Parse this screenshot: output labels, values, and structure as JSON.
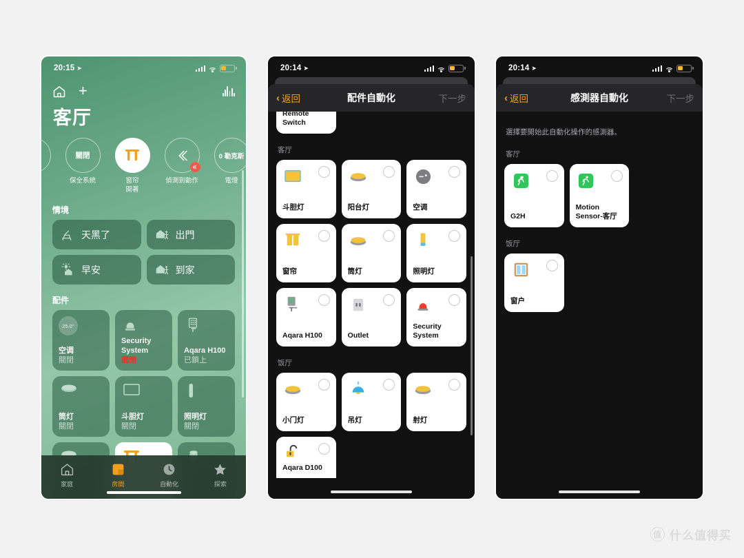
{
  "background_color": "#f2f2f2",
  "screen1": {
    "status_bar": {
      "time": "20:15",
      "location_icon": "location-arrow-icon",
      "cellular_icon": "cellular-bars-icon",
      "wifi_icon": "wifi-icon",
      "battery_icon": "battery-low-icon",
      "battery_color": "#f5b933"
    },
    "nav": {
      "home_icon": "home-icon",
      "add_icon": "plus-icon",
      "intercom_icon": "audio-waveform-icon"
    },
    "room_title": "客厅",
    "status_circles": [
      {
        "value": "",
        "label": "",
        "filled": false,
        "partial": true,
        "icon": "thermostat-dial-icon"
      },
      {
        "value": "關閉",
        "label": "保全系統",
        "filled": false,
        "icon": ""
      },
      {
        "value": "",
        "label": "窗帘\n開著",
        "filled": true,
        "icon": "curtain-icon"
      },
      {
        "value": "",
        "label": "偵測到動作",
        "filled": false,
        "icon": "motion-waves-icon",
        "badge": "motion-badge"
      },
      {
        "value": "0 勒克斯",
        "label": "電燈",
        "filled": false,
        "icon": ""
      }
    ],
    "scenes_title": "情境",
    "scenes": [
      {
        "label": "天黑了",
        "icon": "lounge-chair-icon"
      },
      {
        "label": "出門",
        "icon": "house-leave-icon"
      },
      {
        "label": "早安",
        "icon": "sunrise-house-icon"
      },
      {
        "label": "到家",
        "icon": "house-arrive-icon"
      }
    ],
    "accessories_title": "配件",
    "accessories": [
      {
        "name": "空调",
        "state": "關閉",
        "icon": "thermostat-icon",
        "badge": "25.0°",
        "on": false
      },
      {
        "name": "Security System",
        "state": "關閉",
        "state_alert": true,
        "icon": "siren-icon",
        "on": false
      },
      {
        "name": "Aqara H100",
        "state": "已鎖上",
        "icon": "smart-lock-icon",
        "on": false
      },
      {
        "name": "筒灯",
        "state": "關閉",
        "icon": "downlight-icon",
        "on": false
      },
      {
        "name": "斗胆灯",
        "state": "關閉",
        "icon": "panel-light-icon",
        "on": false
      },
      {
        "name": "照明灯",
        "state": "關閉",
        "icon": "light-strip-icon",
        "on": false
      },
      {
        "name": "",
        "state": "",
        "icon": "downlight-icon",
        "on": false
      },
      {
        "name": "",
        "state": "",
        "icon": "curtain-icon",
        "on": true
      },
      {
        "name": "",
        "state": "",
        "icon": "speaker-icon",
        "on": false
      }
    ],
    "tabs": [
      {
        "label": "家庭",
        "icon": "home-icon",
        "active": false
      },
      {
        "label": "房間",
        "icon": "rooms-icon",
        "active": true
      },
      {
        "label": "自動化",
        "icon": "automation-clock-icon",
        "active": false
      },
      {
        "label": "探索",
        "icon": "star-icon",
        "active": false
      }
    ],
    "accent_color": "#f3a01c"
  },
  "screen2": {
    "status_bar": {
      "time": "20:14",
      "location_icon": "location-arrow-icon",
      "cellular_icon": "cellular-bars-icon",
      "wifi_icon": "wifi-icon",
      "battery_icon": "battery-low-icon",
      "battery_color": "#f5b933"
    },
    "nav": {
      "back_label": "返回",
      "back_icon": "chevron-left-icon",
      "title": "配件自動化",
      "next_label": "下一步"
    },
    "clipped_card_top": {
      "name": "Remote Switch"
    },
    "groups": [
      {
        "title": "客厅",
        "items": [
          {
            "name": "斗胆灯",
            "icon": "panel-light-icon",
            "selected": false
          },
          {
            "name": "阳台灯",
            "icon": "downlight-icon",
            "selected": false
          },
          {
            "name": "空调",
            "icon": "ac-unit-icon",
            "selected": false
          },
          {
            "name": "窗帘",
            "icon": "curtain-icon",
            "selected": false
          },
          {
            "name": "筒灯",
            "icon": "downlight-icon",
            "selected": false
          },
          {
            "name": "照明灯",
            "icon": "light-strip-icon",
            "selected": false
          },
          {
            "name": "Aqara H100",
            "icon": "smart-lock-icon",
            "selected": false
          },
          {
            "name": "Outlet",
            "icon": "outlet-icon",
            "selected": false
          },
          {
            "name": "Security System",
            "icon": "siren-icon",
            "selected": false
          }
        ]
      },
      {
        "title": "饭厅",
        "items": [
          {
            "name": "小门灯",
            "icon": "downlight-icon",
            "selected": false
          },
          {
            "name": "吊灯",
            "icon": "pendant-lamp-icon",
            "selected": false
          },
          {
            "name": "射灯",
            "icon": "downlight-icon",
            "selected": false
          },
          {
            "name": "Aqara D100",
            "icon": "padlock-open-icon",
            "selected": false
          }
        ]
      }
    ]
  },
  "screen3": {
    "status_bar": {
      "time": "20:14",
      "location_icon": "location-arrow-icon",
      "cellular_icon": "cellular-bars-icon",
      "wifi_icon": "wifi-icon",
      "battery_icon": "battery-low-icon",
      "battery_color": "#f5b933"
    },
    "nav": {
      "back_label": "返回",
      "back_icon": "chevron-left-icon",
      "title": "感測器自動化",
      "next_label": "下一步"
    },
    "hint": "選擇要開始此自動化操作的感測器。",
    "groups": [
      {
        "title": "客厅",
        "items": [
          {
            "name": "G2H",
            "icon": "motion-sensor-icon",
            "selected": false
          },
          {
            "name": "Motion Sensor-客厅",
            "icon": "motion-sensor-icon",
            "selected": false
          }
        ]
      },
      {
        "title": "饭厅",
        "items": [
          {
            "name": "窗户",
            "icon": "window-icon",
            "selected": false
          }
        ]
      }
    ]
  },
  "watermark": {
    "badge": "值",
    "text": "什么值得买"
  }
}
